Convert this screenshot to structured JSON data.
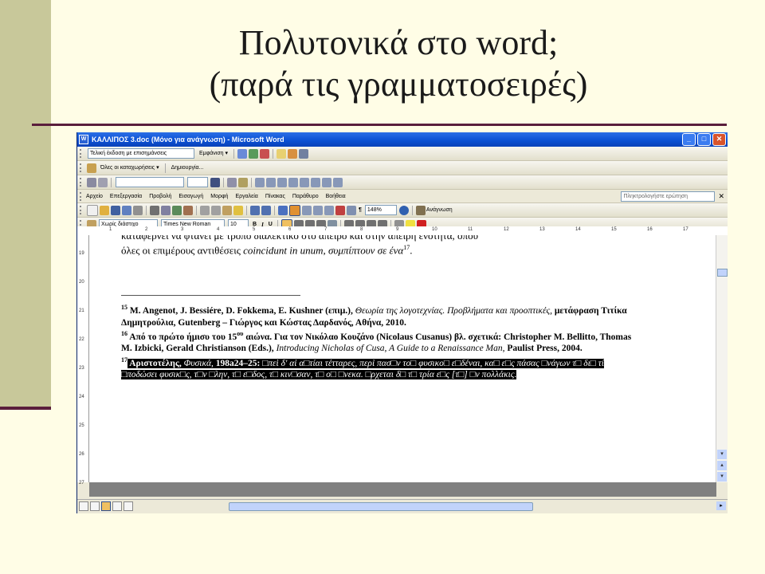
{
  "slide": {
    "title_line1": "Πολυτονικά στο word;",
    "title_line2": "(παρά τις γραμματοσειρές)"
  },
  "window": {
    "title": "ΚΑΛΛΙΠΟΣ 3.doc (Μόνο για ανάγνωση) - Microsoft Word",
    "minimize": "_",
    "maximize": "□",
    "close": "✕"
  },
  "reviewing_toolbar": {
    "display_dropdown": "Τελική έκδοση με επισημάνσεις",
    "show_button": "Εμφάνιση ▾"
  },
  "autotext_toolbar": {
    "entries_dropdown": "Όλες οι καταχωρήσεις ▾",
    "create_button": "Δημιουργία..."
  },
  "menu": {
    "items": [
      "Αρχείο",
      "Επεξεργασία",
      "Προβολή",
      "Εισαγωγή",
      "Μορφή",
      "Εργαλεία",
      "Πίνακας",
      "Παράθυρο",
      "Βοήθεια"
    ],
    "help_placeholder": "Πληκτρολογήστε ερώτηση",
    "close_doc": "✕"
  },
  "standard_toolbar": {
    "zoom": "148%",
    "read_button": "Ανάγνωση"
  },
  "format_toolbar": {
    "style": "Χωρίς διάστιχο",
    "font": "Times New Roman",
    "size": "10",
    "bold": "B",
    "italic": "I",
    "underline": "U"
  },
  "ruler": {
    "numbers": [
      "1",
      "2",
      "3",
      "4",
      "5",
      "6",
      "7",
      "8",
      "9",
      "10",
      "11",
      "12",
      "13",
      "14",
      "15",
      "16",
      "17"
    ]
  },
  "vruler": {
    "numbers": [
      "19",
      "20",
      "21",
      "22",
      "23",
      "24",
      "25",
      "26",
      "27"
    ]
  },
  "document": {
    "cut_line": "καταφέρνει να φτάνει με τρόπο διαλεκτικό στο άπειρο και στην άπειρη ενότητα, όπου",
    "main_line_start": "όλες οι επιμέρους αντιθέσεις ",
    "main_line_italic": "coincidunt in unum, συμπίπτουν σε ένα",
    "main_line_sup": "17",
    "main_line_end": ".",
    "fn15_num": "15",
    "fn15_a": " M. Angenot, J. Bessiére, D. Fokkema, E. Kushner (επιμ.), ",
    "fn15_i": "Θεωρία της λογοτεχνίας. Προβλήματα και προοπτικές,",
    "fn15_b": " μετάφραση Τιτίκα Δημητρούλια, Gutenberg – Γιώργος και Κώστας Δαρδανός, Αθήνα, 2010.",
    "fn16_num": "16",
    "fn16_a": " Από το πρώτο ήμισυ του 15",
    "fn16_sup": "ου",
    "fn16_b": " αιώνα. Για τον Νικόλαο Κουζάνο (Nicolaus Cusanus) βλ. σχετικά: Christopher M. Bellitto, Thomas M. Izbicki, Gerald Christianson (Eds.), ",
    "fn16_i": "Introducing Nicholas of Cusa, A Guide to a Renaissance Man,",
    "fn16_c": " Paulist Press, 2004.",
    "fn17_num": "17",
    "fn17_a": " Αριστοτέλης, ",
    "fn17_i": "Φυσικά,",
    "fn17_b": " 198a24–25: ",
    "fn17_c": "□πεὶ δ' αἱ α□τίαι τέτταρες, περὶ πασ□ν το□ φυσικο□ ε□δέναι, κα□ ε□ς πάσας □νάγων τ□ δι□ τί □ποδώσει φυσικ□ς, τ□ν □λην, τ□ ε□δος, τ□ κιν□σαν, τ□ ο□ □νεκα. □ρχεται δ□ τ□ τρία ε□ς [τ□] □ν πολλάκις."
  }
}
